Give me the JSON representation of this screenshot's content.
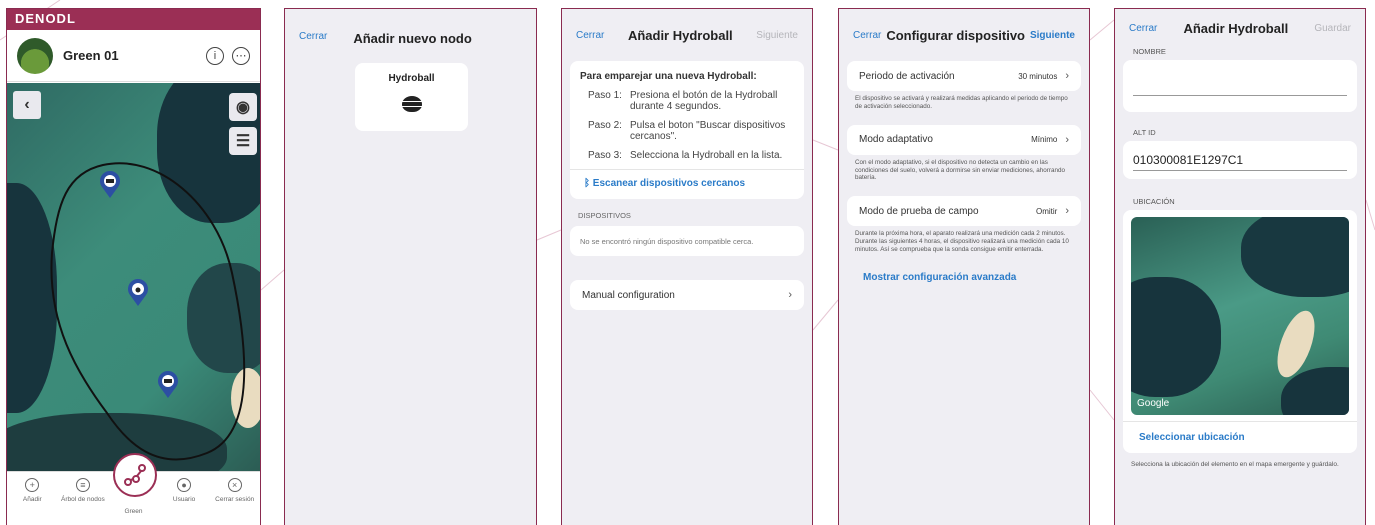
{
  "screen1": {
    "brand": "DENODL",
    "green_title": "Green 01",
    "info_icon": "info-icon",
    "more_icon": "more-icon",
    "tabs": [
      {
        "label": "Añadir",
        "icon": "plus-icon"
      },
      {
        "label": "Árbol de nodos",
        "icon": "list-icon"
      },
      {
        "label": "Green",
        "icon": "graph-icon"
      },
      {
        "label": "Usuario",
        "icon": "user-icon"
      },
      {
        "label": "Cerrar sesión",
        "icon": "close-icon"
      }
    ]
  },
  "screen2": {
    "close": "Cerrar",
    "title": "Añadir nuevo nodo",
    "device_card": "Hydroball"
  },
  "screen3": {
    "close": "Cerrar",
    "title": "Añadir Hydroball",
    "next": "Siguiente",
    "intro": "Para emparejar una nueva Hydroball:",
    "steps": [
      {
        "k": "Paso 1:",
        "v": "Presiona el botón de la Hydroball durante 4 segundos."
      },
      {
        "k": "Paso 2:",
        "v": "Pulsa el boton \"Buscar dispositivos cercanos\"."
      },
      {
        "k": "Paso 3:",
        "v": "Selecciona la Hydroball en la lista."
      }
    ],
    "scan": "Escanear dispositivos cercanos",
    "devices_label": "DISPOSITIVOS",
    "no_devices": "No se encontró ningún dispositivo compatible cerca.",
    "manual": "Manual configuration"
  },
  "screen4": {
    "close": "Cerrar",
    "title": "Configurar dispositivo",
    "next": "Siguiente",
    "rows": [
      {
        "label": "Periodo de activación",
        "value": "30 minutos",
        "desc": "El dispositivo se activará y realizará medidas aplicando el periodo de tiempo de activación seleccionado."
      },
      {
        "label": "Modo adaptativo",
        "value": "Mínimo",
        "desc": "Con el modo adaptativo, si el dispositivo no detecta un cambio en las condiciones del suelo, volverá a dormirse sin enviar mediciones, ahorrando batería."
      },
      {
        "label": "Modo de prueba de campo",
        "value": "Omitir",
        "desc": "Durante la próxima hora, el aparato realizará una medición cada 2 minutos. Durante las siguientes 4 horas, el dispositivo realizará una medición cada 10 minutos. Así se comprueba que la sonda consigue emitir enterrada."
      }
    ],
    "advanced": "Mostrar configuración avanzada"
  },
  "screen5": {
    "close": "Cerrar",
    "title": "Añadir Hydroball",
    "save": "Guardar",
    "name_label": "NOMBRE",
    "name_value": "",
    "altid_label": "ALT ID",
    "altid_value": "010300081E1297C1",
    "location_label": "UBICACIÓN",
    "map_brand": "Google",
    "select_location": "Seleccionar ubicación",
    "location_help": "Selecciona la ubicación del elemento en el mapa emergente y guárdalo."
  }
}
